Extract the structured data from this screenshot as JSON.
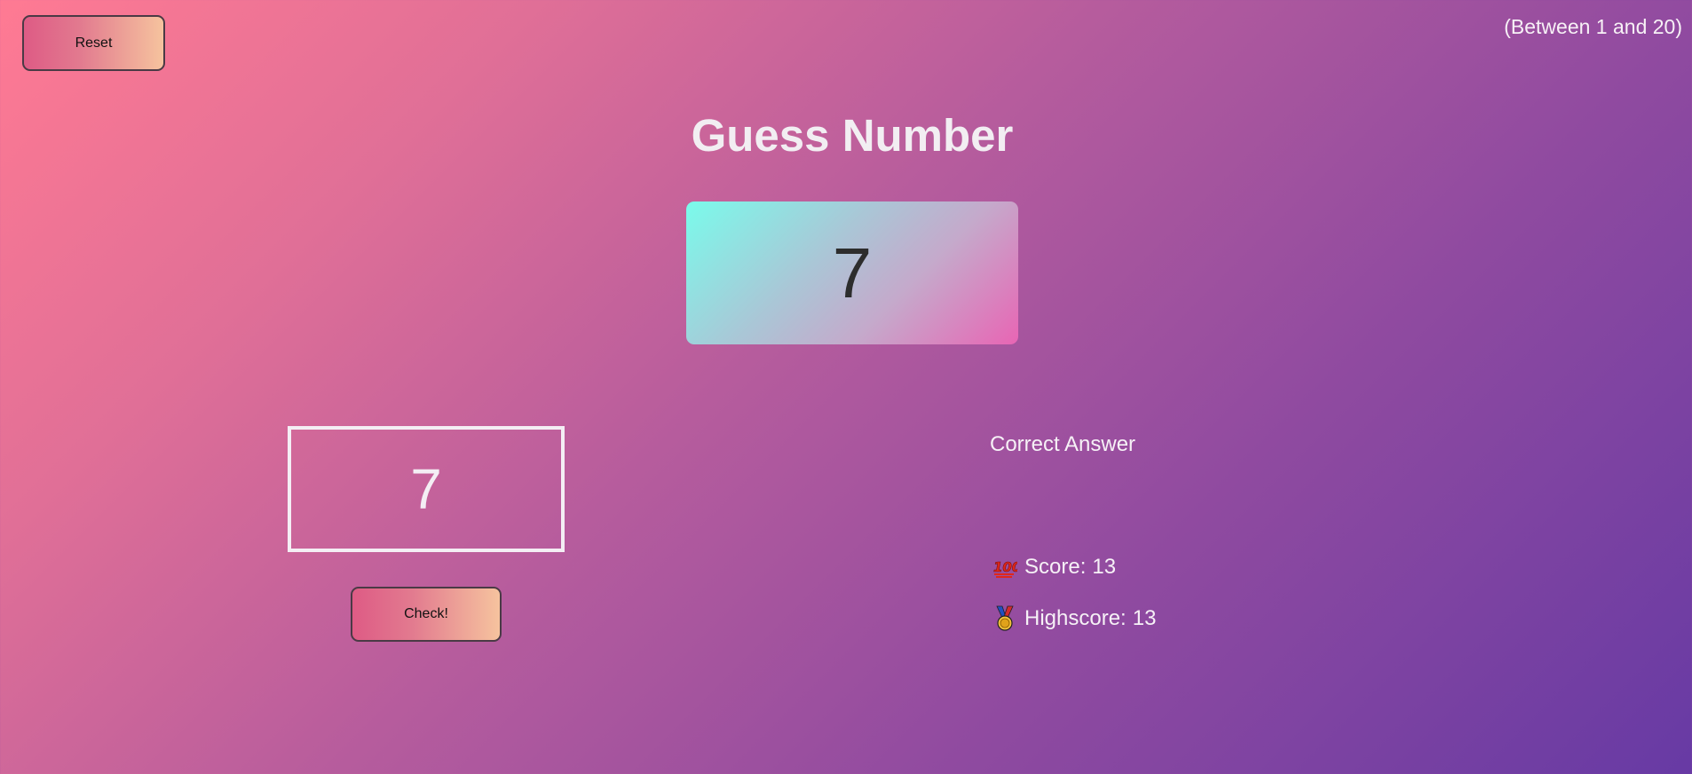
{
  "header": {
    "reset_label": "Reset",
    "range_note": "(Between 1 and 20)",
    "title": "Guess Number"
  },
  "secret": {
    "number": "7"
  },
  "guess": {
    "value": "7",
    "check_label": "Check!"
  },
  "status": {
    "message": "Correct Answer",
    "score_icon": "hundred-points-icon",
    "score_label": "Score:",
    "score_value": "13",
    "highscore_icon": "medal-icon",
    "highscore_label": "Highscore:",
    "highscore_value": "13"
  },
  "colors": {
    "bg_start": "#ff7a93",
    "bg_end": "#673aa4",
    "secret_start": "#7afbeb",
    "secret_end": "#e865b4",
    "button_start": "#de5b85",
    "button_end": "#f6c39e"
  }
}
